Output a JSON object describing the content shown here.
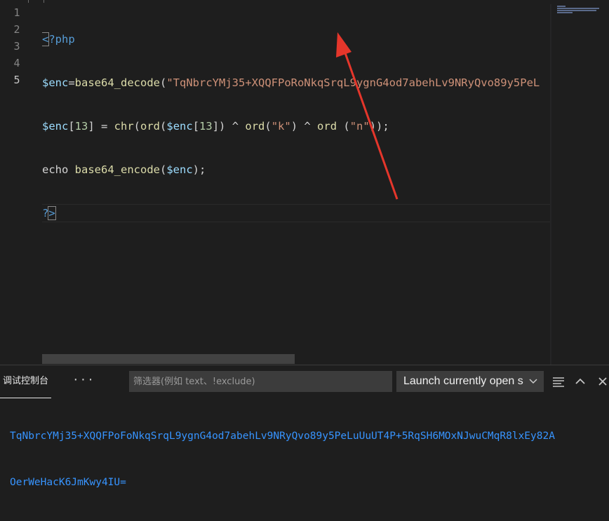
{
  "editor": {
    "line_numbers": [
      "1",
      "2",
      "3",
      "4",
      "5"
    ],
    "lines": {
      "l1": {
        "open_tag": "<",
        "rest": "?php"
      },
      "l2": {
        "var": "$enc",
        "eq": "=",
        "fn": "base64_decode",
        "paren": "(",
        "str": "\"TqNbrcYMj35+XQQFPoRoNkqSrqL9ygnG4od7abehLv9NRyQvo89y5PeL"
      },
      "l3": {
        "var1": "$enc",
        "idx_open": "[",
        "num1": "13",
        "idx_close_eq": "] = ",
        "chr": "chr",
        "p1": "(",
        "ord1": "ord",
        "p2": "(",
        "var2": "$enc",
        "idx2_open": "[",
        "num2": "13",
        "idx2_close": "]) ^ ",
        "ord2": "ord",
        "p3": "(",
        "str_k": "\"k\"",
        "p4": ") ^ ",
        "ord3": "ord",
        "p5": " (",
        "str_n": "\"n\"",
        "end": "));"
      },
      "l4": {
        "kw": "echo ",
        "fn": "base64_encode",
        "p": "(",
        "var": "$enc",
        "end": ");"
      },
      "l5": {
        "tag": "?",
        "close": ">"
      }
    }
  },
  "panel": {
    "tab_label": "调试控制台",
    "more_label": "···",
    "filter_placeholder": "筛选器(例如 text、!exclude)",
    "launch_label": "Launch currently open s",
    "output": [
      "TqNbrcYMj35+XQQFPoFoNkqSrqL9ygnG4od7abehLv9NRyQvo89y5PeLuUuUT4P+5RqSH6MOxNJwuCMqR8lxEy82A",
      "OerWeHacK6JmKwy4IU="
    ]
  },
  "icons": {
    "chevron": "chevron-down-icon",
    "wrap": "word-wrap-icon",
    "up": "chevron-up-icon",
    "close": "close-icon"
  },
  "colors": {
    "arrow": "#e5362b",
    "output_text": "#3794ff",
    "string": "#ce9178",
    "variable": "#9cdcfe",
    "function": "#dcdcaa",
    "tag": "#569cd6"
  }
}
